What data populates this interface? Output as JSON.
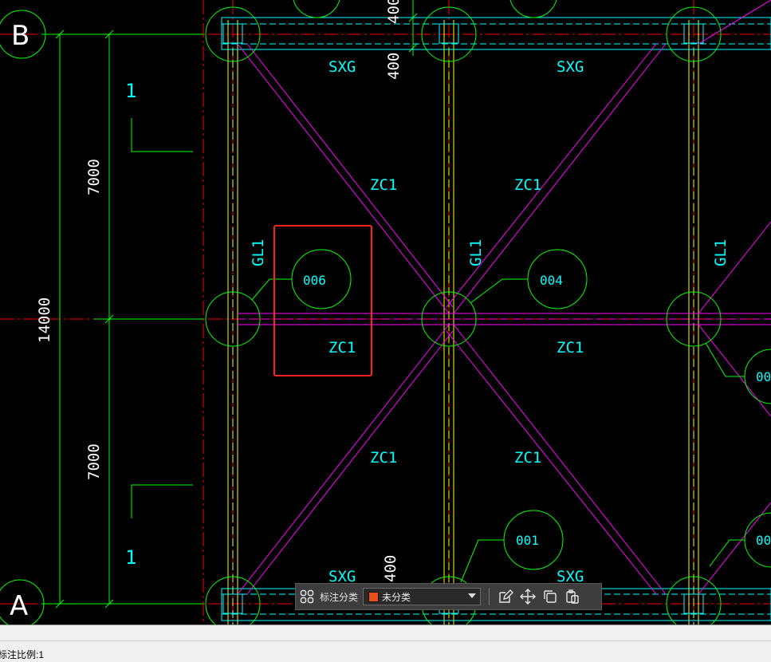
{
  "axes": {
    "rows": [
      {
        "label": "B"
      },
      {
        "label": "A"
      }
    ]
  },
  "dimensions": {
    "overall": "14000",
    "upper": "7000",
    "lower": "7000",
    "top_small_a": "400",
    "top_small_b": "400",
    "bottom_small": "400"
  },
  "section_marks": {
    "top": "1",
    "bottom": "1"
  },
  "member_labels": {
    "sxg_tl": "SXG",
    "sxg_tr": "SXG",
    "sxg_bl": "SXG",
    "sxg_br": "SXG",
    "zc1_1": "ZC1",
    "zc1_2": "ZC1",
    "zc1_3": "ZC1",
    "zc1_4": "ZC1",
    "zc1_5": "ZC1",
    "zc1_6": "ZC1",
    "gl1_left": "GL1",
    "gl1_mid": "GL1",
    "gl1_right": "GL1"
  },
  "balloons": {
    "b006": "006",
    "b004": "004",
    "b001": "001",
    "b_right_a": "00",
    "b_right_b": "00"
  },
  "toolbar": {
    "label": "标注分类",
    "selected_option": "未分类",
    "swatch_color": "#e8501a",
    "icons": [
      "grid-icon",
      "edit-icon",
      "move-icon",
      "copy-icon",
      "paste-icon"
    ]
  },
  "status": {
    "text": "标注比例:1"
  },
  "colors": {
    "green": "#00ff00",
    "cyan": "#00ffff",
    "magenta": "#ff00ff",
    "yellow": "#ffff00",
    "red": "#ff0000",
    "highlight": "#ff2020"
  }
}
